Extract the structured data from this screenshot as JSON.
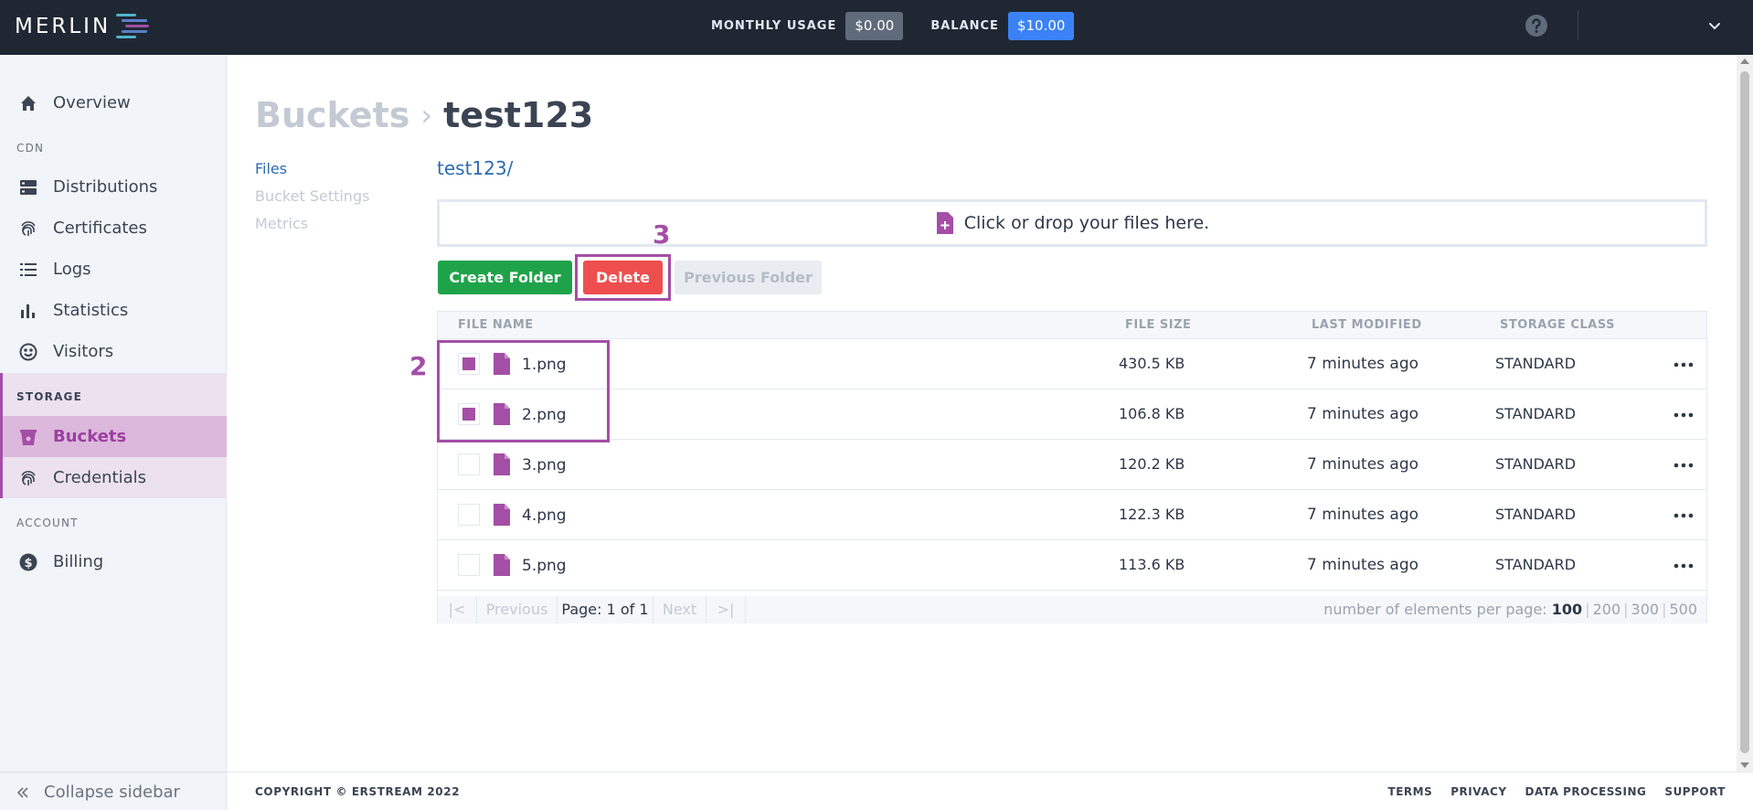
{
  "app": {
    "logo_text": "MERLIN"
  },
  "topbar": {
    "usage_label": "MONTHLY USAGE",
    "usage_value": "$0.00",
    "balance_label": "BALANCE",
    "balance_value": "$10.00"
  },
  "sidebar": {
    "overview": "Overview",
    "section_cdn": "CDN",
    "distributions": "Distributions",
    "certificates": "Certificates",
    "logs": "Logs",
    "statistics": "Statistics",
    "visitors": "Visitors",
    "section_storage": "STORAGE",
    "buckets": "Buckets",
    "credentials": "Credentials",
    "section_account": "ACCOUNT",
    "billing": "Billing",
    "collapse": "Collapse sidebar"
  },
  "breadcrumb": {
    "parent": "Buckets",
    "current": "test123"
  },
  "subnav": {
    "files": "Files",
    "bucket_settings": "Bucket Settings",
    "metrics": "Metrics"
  },
  "path": "test123/",
  "dropzone": "Click or drop your files here.",
  "buttons": {
    "create_folder": "Create Folder",
    "delete": "Delete",
    "previous_folder": "Previous Folder"
  },
  "annotations": {
    "rows_marker": "2",
    "delete_marker": "3"
  },
  "table": {
    "headers": [
      "FILE NAME",
      "FILE SIZE",
      "LAST MODIFIED",
      "STORAGE CLASS"
    ],
    "rows": [
      {
        "name": "1.png",
        "size": "430.5 KB",
        "modified": "7 minutes ago",
        "class": "STANDARD",
        "checked": true
      },
      {
        "name": "2.png",
        "size": "106.8 KB",
        "modified": "7 minutes ago",
        "class": "STANDARD",
        "checked": true
      },
      {
        "name": "3.png",
        "size": "120.2 KB",
        "modified": "7 minutes ago",
        "class": "STANDARD",
        "checked": false
      },
      {
        "name": "4.png",
        "size": "122.3 KB",
        "modified": "7 minutes ago",
        "class": "STANDARD",
        "checked": false
      },
      {
        "name": "5.png",
        "size": "113.6 KB",
        "modified": "7 minutes ago",
        "class": "STANDARD",
        "checked": false
      }
    ]
  },
  "pagination": {
    "first": "|<",
    "previous": "Previous",
    "page": "Page: 1 of 1",
    "next": "Next",
    "last": ">|",
    "per_page_label": "number of elements per page:",
    "per_page_options": [
      "100",
      "200",
      "300",
      "500"
    ]
  },
  "footer": {
    "copyright": "COPYRIGHT © ERSTREAM 2022",
    "links": [
      "TERMS",
      "PRIVACY",
      "DATA PROCESSING",
      "SUPPORT"
    ]
  },
  "colors": {
    "accent": "#a44ea6",
    "topbar": "#1f2733",
    "green": "#1fa34a",
    "red": "#ef4e4e",
    "blue": "#3b82f6",
    "link": "#2b6cb0"
  },
  "icons": [
    "home-icon",
    "server-icon",
    "fingerprint-icon",
    "list-icon",
    "bar-chart-icon",
    "smiley-icon",
    "bucket-icon",
    "dollar-icon",
    "file-plus-icon",
    "file-icon",
    "more-icon",
    "help-icon",
    "chevron-down-icon",
    "double-chevron-left-icon"
  ]
}
